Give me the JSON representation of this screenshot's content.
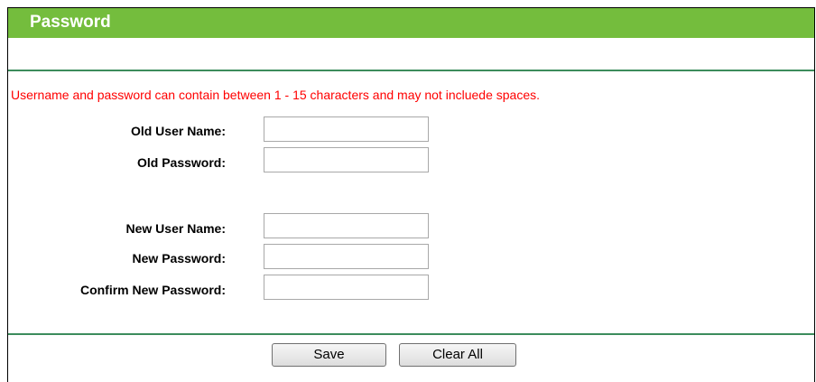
{
  "header": {
    "title": "Password"
  },
  "notice": "Username and password can contain between 1 - 15 characters and may not incluede spaces.",
  "form": {
    "old_user_name": {
      "label": "Old User Name:",
      "value": ""
    },
    "old_password": {
      "label": "Old Password:",
      "value": ""
    },
    "new_user_name": {
      "label": "New User Name:",
      "value": ""
    },
    "new_password": {
      "label": "New Password:",
      "value": ""
    },
    "confirm_new_password": {
      "label": "Confirm New Password:",
      "value": ""
    }
  },
  "buttons": {
    "save": "Save",
    "clear_all": "Clear All"
  },
  "colors": {
    "title_bar": "#74bd3d",
    "rule": "#3c8c5c",
    "notice": "#ff0000"
  }
}
